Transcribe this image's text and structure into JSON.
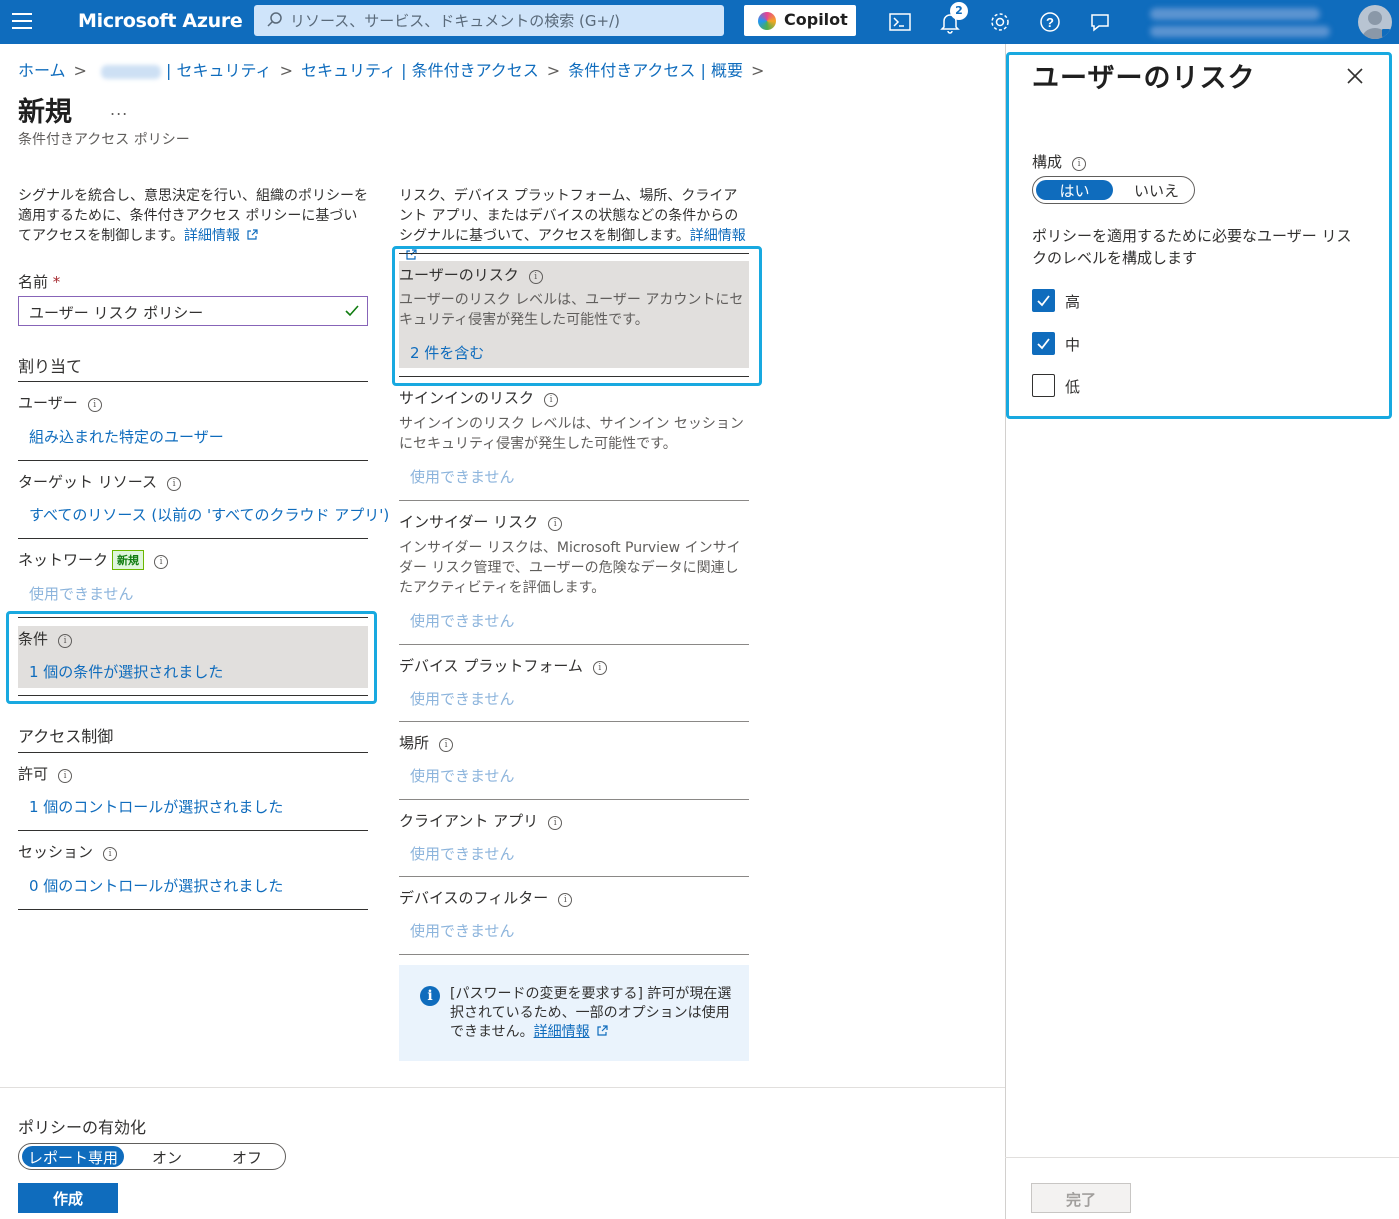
{
  "topbar": {
    "brand": "Microsoft Azure",
    "search_placeholder": "リソース、サービス、ドキュメントの検索 (G+/)",
    "copilot_label": "Copilot",
    "notification_count": "2"
  },
  "breadcrumb": {
    "home": "ホーム",
    "security": "| セキュリティ",
    "ca": "セキュリティ | 条件付きアクセス",
    "overview": "条件付きアクセス | 概要"
  },
  "page": {
    "title": "新規",
    "more": "...",
    "subtitle": "条件付きアクセス ポリシー"
  },
  "left": {
    "desc": "シグナルを統合し、意思決定を行い、組織のポリシーを適用するために、条件付きアクセス ポリシーに基づいてアクセスを制御します。",
    "desc_link": "詳細情報",
    "name_label": "名前",
    "name_required": "*",
    "name_value": "ユーザー リスク ポリシー",
    "assignments_heading": "割り当て",
    "users_label": "ユーザー",
    "users_value": "組み込まれた特定のユーザー",
    "target_label": "ターゲット リソース",
    "target_value": "すべてのリソース (以前の 'すべてのクラウド アプリ')",
    "network_label": "ネットワーク",
    "network_badge": "新規",
    "network_value": "使用できません",
    "conditions_label": "条件",
    "conditions_value": "1 個の条件が選択されました",
    "access_heading": "アクセス制御",
    "grant_label": "許可",
    "grant_value": "1 個のコントロールが選択されました",
    "session_label": "セッション",
    "session_value": "0 個のコントロールが選択されました"
  },
  "middle": {
    "desc": "リスク、デバイス プラットフォーム、場所、クライアント アプリ、またはデバイスの状態などの条件からのシグナルに基づいて、アクセスを制御します。",
    "desc_link": "詳細情報",
    "user_risk_label": "ユーザーのリスク",
    "user_risk_desc": "ユーザーのリスク レベルは、ユーザー アカウントにセキュリティ侵害が発生した可能性です。",
    "user_risk_value": "2 件を含む",
    "signin_risk_label": "サインインのリスク",
    "signin_risk_desc": "サインインのリスク レベルは、サインイン セッションにセキュリティ侵害が発生した可能性です。",
    "signin_risk_value": "使用できません",
    "insider_label": "インサイダー リスク",
    "insider_desc": "インサイダー リスクは、Microsoft Purview インサイダー リスク管理で、ユーザーの危険なデータに関連したアクティビティを評価します。",
    "insider_value": "使用できません",
    "platform_label": "デバイス プラットフォーム",
    "platform_value": "使用できません",
    "location_label": "場所",
    "location_value": "使用できません",
    "client_label": "クライアント アプリ",
    "client_value": "使用できません",
    "filter_label": "デバイスのフィルター",
    "filter_value": "使用できません",
    "infobar_text": "[パスワードの変更を要求する] 許可が現在選択されているため、一部のオプションは使用できません。",
    "infobar_link": "詳細情報"
  },
  "footer": {
    "enable_label": "ポリシーの有効化",
    "opt_report": "レポート専用",
    "opt_on": "オン",
    "opt_off": "オフ",
    "create_button": "作成"
  },
  "panel": {
    "title": "ユーザーのリスク",
    "config_label": "構成",
    "yes": "はい",
    "no": "いいえ",
    "instruction": "ポリシーを適用するために必要なユーザー リスクのレベルを構成します",
    "levels": [
      {
        "label": "高",
        "checked": true
      },
      {
        "label": "中",
        "checked": true
      },
      {
        "label": "低",
        "checked": false
      }
    ],
    "done_button": "完了"
  },
  "colors": {
    "brand_blue": "#0f6cbd",
    "highlight": "#18a9e0"
  }
}
